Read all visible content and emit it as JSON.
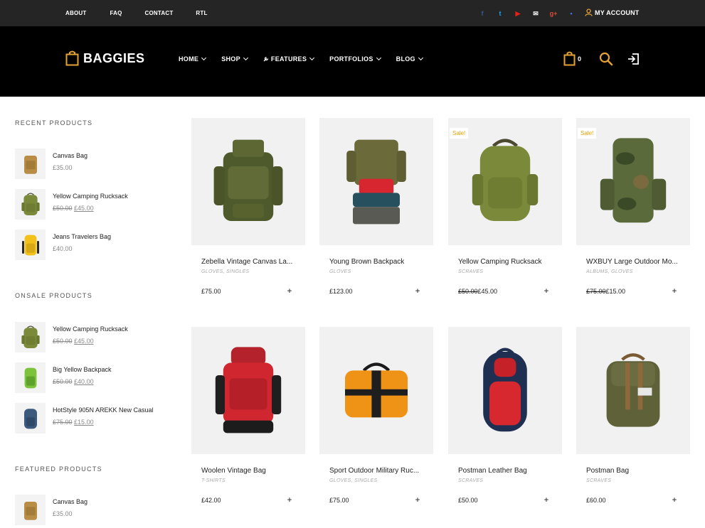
{
  "topbar": {
    "links": [
      "ABOUT",
      "FAQ",
      "CONTACT",
      "RTL"
    ],
    "social_icons": [
      {
        "name": "facebook-icon",
        "glyph": "f",
        "color": "#3b5998"
      },
      {
        "name": "twitter-icon",
        "glyph": "t",
        "color": "#1da1f2"
      },
      {
        "name": "youtube-icon",
        "glyph": "▶",
        "color": "#e62117"
      },
      {
        "name": "email-icon",
        "glyph": "✉",
        "color": "#ffffff"
      },
      {
        "name": "google-plus-icon",
        "glyph": "g+",
        "color": "#dd4b39"
      },
      {
        "name": "chat-icon",
        "glyph": "▪",
        "color": "#3b7bdc"
      }
    ],
    "account_label": "MY ACCOUNT"
  },
  "header": {
    "logo_text": "BAGGIES",
    "accent": "#e4a236",
    "nav": [
      "HOME",
      "SHOP",
      "FEATURES",
      "PORTFOLIOS",
      "BLOG"
    ],
    "cart_count": "0"
  },
  "sidebar": {
    "recent_title": "RECENT PRODUCTS",
    "recent": [
      {
        "name": "Canvas Bag",
        "price": "£35.00",
        "old_price": ""
      },
      {
        "name": "Yellow Camping Rucksack",
        "price": "£45.00",
        "old_price": "£50.00"
      },
      {
        "name": "Jeans Travelers Bag",
        "price": "£40.00",
        "old_price": ""
      }
    ],
    "onsale_title": "ONSALE PRODUCTS",
    "onsale": [
      {
        "name": "Yellow Camping Rucksack",
        "price": "£45.00",
        "old_price": "£50.00"
      },
      {
        "name": "Big Yellow Backpack",
        "price": "£40.00",
        "old_price": "£50.00"
      },
      {
        "name": "HotStyle 905N AREKK New Casual",
        "price": "£15.00",
        "old_price": "£75.00"
      }
    ],
    "featured_title": "FEATURED PRODUCTS",
    "featured": [
      {
        "name": "Canvas Bag",
        "price": "£35.00",
        "old_price": ""
      }
    ]
  },
  "products": [
    {
      "title": "Zebella Vintage Canvas La...",
      "cats": "GLOVES, SINGLES",
      "price": "£75.00",
      "old_price": "",
      "sale": ""
    },
    {
      "title": "Young Brown Backpack",
      "cats": "GLOVES",
      "price": "£123.00",
      "old_price": "",
      "sale": ""
    },
    {
      "title": "Yellow Camping Rucksack",
      "cats": "SCRAVES",
      "price": "£45.00",
      "old_price": "£50.00",
      "sale": "Sale!"
    },
    {
      "title": "WXBUY Large Outdoor Mo...",
      "cats": "ALBUMS, GLOVES",
      "price": "£15.00",
      "old_price": "£75.00",
      "sale": "Sale!"
    },
    {
      "title": "Woolen Vintage Bag",
      "cats": "T-SHIRTS",
      "price": "£42.00",
      "old_price": "",
      "sale": ""
    },
    {
      "title": "Sport Outdoor Military Ruc...",
      "cats": "GLOVES, SINGLES",
      "price": "£75.00",
      "old_price": "",
      "sale": ""
    },
    {
      "title": "Postman Leather Bag",
      "cats": "SCRAVES",
      "price": "£50.00",
      "old_price": "",
      "sale": ""
    },
    {
      "title": "Postman Bag",
      "cats": "SCRAVES",
      "price": "£60.00",
      "old_price": "",
      "sale": ""
    }
  ],
  "add_glyph": "+"
}
